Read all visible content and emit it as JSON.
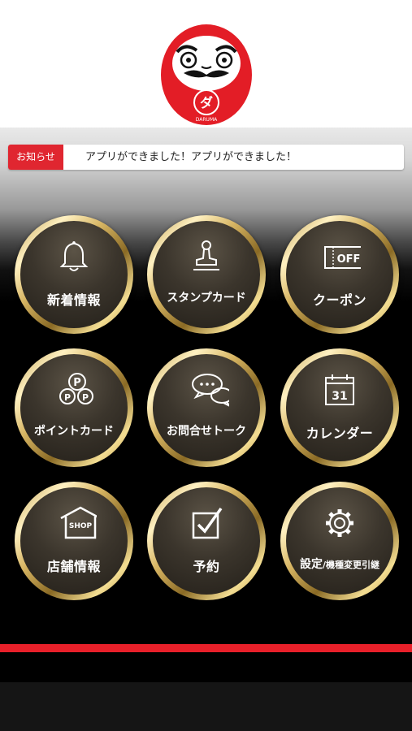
{
  "header": {
    "logo_name": "daruma-logo",
    "logo_text": "DARUMA",
    "logo_glyph": "ダ"
  },
  "news": {
    "tag": "お知らせ",
    "text": "アプリができました！アプリができました！"
  },
  "menu": [
    {
      "id": "news",
      "label": "新着情報",
      "icon": "bell-icon"
    },
    {
      "id": "stamp-card",
      "label": "スタンプカード",
      "icon": "stamp-icon"
    },
    {
      "id": "coupon",
      "label": "クーポン",
      "icon": "coupon-off-icon",
      "icon_text": "OFF"
    },
    {
      "id": "point-card",
      "label": "ポイントカード",
      "icon": "points-icon",
      "icon_text": "P"
    },
    {
      "id": "contact-talk",
      "label": "お問合せトーク",
      "icon": "chat-bubbles-icon"
    },
    {
      "id": "calendar",
      "label": "カレンダー",
      "icon": "calendar-icon",
      "icon_text": "31"
    },
    {
      "id": "store-info",
      "label": "店舗情報",
      "icon": "shop-icon",
      "icon_text": "SHOP"
    },
    {
      "id": "reservation",
      "label": "予約",
      "icon": "checkbox-icon"
    },
    {
      "id": "settings",
      "label": "設定",
      "label_sub": "/機種変更引継",
      "icon": "gear-icon"
    }
  ],
  "colors": {
    "accent_red": "#e8202a",
    "gold": "#d7b563",
    "button_dark": "#3b352c"
  }
}
